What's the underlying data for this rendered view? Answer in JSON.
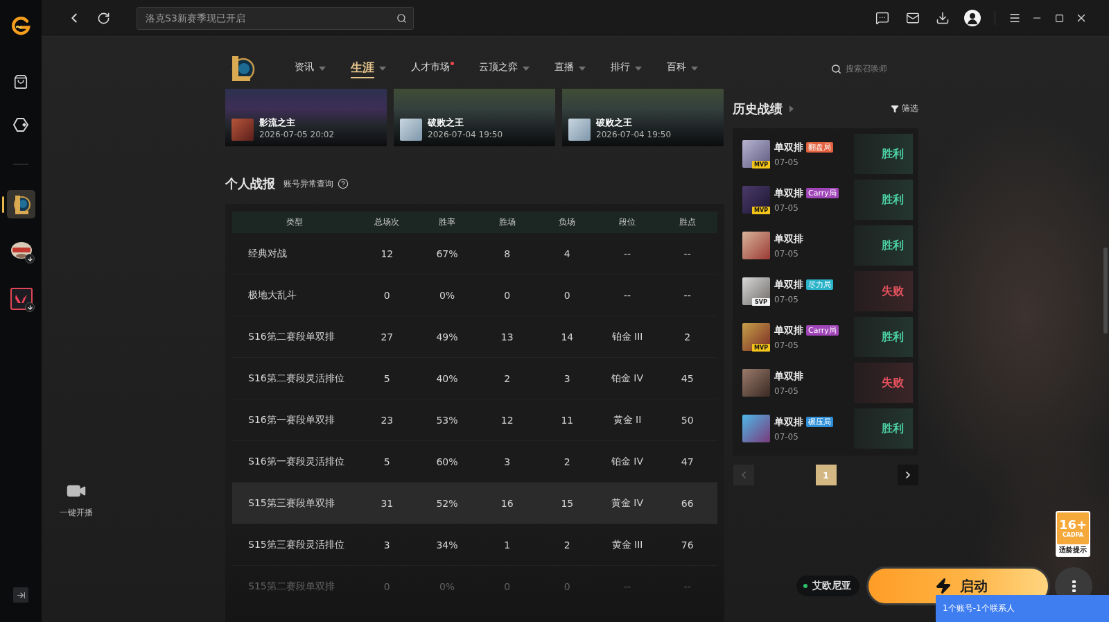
{
  "side_rail": {
    "games": [
      {
        "kind": "emblem",
        "selected": true,
        "installing": false
      },
      {
        "kind": "crest",
        "selected": false,
        "installing": true
      },
      {
        "kind": "square",
        "selected": false,
        "installing": true
      }
    ],
    "live_button": {
      "label": "一键开播"
    }
  },
  "top_bar": {
    "search": {
      "placeholder": "洛克S3新赛季现已开启"
    }
  },
  "game_nav": {
    "tabs": [
      {
        "label": "资讯",
        "selected": false,
        "dropdown": true,
        "dot": false
      },
      {
        "label": "生涯",
        "selected": true,
        "dropdown": true,
        "dot": false
      },
      {
        "label": "人才市场",
        "selected": false,
        "dropdown": false,
        "dot": true
      },
      {
        "label": "云顶之弈",
        "selected": false,
        "dropdown": true,
        "dot": false
      },
      {
        "label": "直播",
        "selected": false,
        "dropdown": true,
        "dot": false
      },
      {
        "label": "排行",
        "selected": false,
        "dropdown": true,
        "dot": false
      },
      {
        "label": "百科",
        "selected": false,
        "dropdown": true,
        "dot": false
      }
    ],
    "search": {
      "placeholder": "搜索召唤师"
    }
  },
  "highlights": [
    {
      "champion": "影流之主",
      "time": "2026-07-05 20:02"
    },
    {
      "champion": "破败之王",
      "time": "2026-07-04 19:50"
    },
    {
      "champion": "破败之王",
      "time": "2026-07-04 19:50"
    }
  ],
  "personal_stats": {
    "title": "个人战报",
    "link": "账号异常查询",
    "table": {
      "columns": [
        "类型",
        "总场次",
        "胜率",
        "胜场",
        "负场",
        "段位",
        "胜点"
      ],
      "rows": [
        {
          "cells": [
            "经典对战",
            "12",
            "67%",
            "8",
            "4",
            "--",
            "--"
          ],
          "highlighted": false
        },
        {
          "cells": [
            "极地大乱斗",
            "0",
            "0%",
            "0",
            "0",
            "--",
            "--"
          ],
          "highlighted": false
        },
        {
          "cells": [
            "S16第二赛段单双排",
            "27",
            "49%",
            "13",
            "14",
            "铂金 III",
            "2"
          ],
          "highlighted": false
        },
        {
          "cells": [
            "S16第二赛段灵活排位",
            "5",
            "40%",
            "2",
            "3",
            "铂金 IV",
            "45"
          ],
          "highlighted": false
        },
        {
          "cells": [
            "S16第一赛段单双排",
            "23",
            "53%",
            "12",
            "11",
            "黄金 II",
            "50"
          ],
          "highlighted": false
        },
        {
          "cells": [
            "S16第一赛段灵活排位",
            "5",
            "60%",
            "3",
            "2",
            "铂金 IV",
            "47"
          ],
          "highlighted": false
        },
        {
          "cells": [
            "S15第三赛段单双排",
            "31",
            "52%",
            "16",
            "15",
            "黄金 IV",
            "66"
          ],
          "highlighted": true
        },
        {
          "cells": [
            "S15第三赛段灵活排位",
            "3",
            "34%",
            "1",
            "2",
            "黄金 III",
            "76"
          ],
          "highlighted": false
        },
        {
          "cells": [
            "S15第二赛段单双排",
            "0",
            "0%",
            "0",
            "0",
            "--",
            "--"
          ],
          "highlighted": false
        }
      ]
    }
  },
  "history": {
    "title": "历史战绩",
    "filter": "筛选",
    "matches": [
      {
        "mode": "单双排",
        "tag": {
          "label": "翻盘局",
          "color": "#e2623f"
        },
        "badge": {
          "label": "MVP",
          "kind": "mvp"
        },
        "date": "07-05",
        "result": "胜利",
        "kind": "win"
      },
      {
        "mode": "单双排",
        "tag": {
          "label": "Carry局",
          "color": "#a046b8"
        },
        "badge": {
          "label": "MVP",
          "kind": "mvp"
        },
        "date": "07-05",
        "result": "胜利",
        "kind": "win"
      },
      {
        "mode": "单双排",
        "date": "07-05",
        "result": "胜利",
        "kind": "win"
      },
      {
        "mode": "单双排",
        "tag": {
          "label": "尽力局",
          "color": "#2ab3c9"
        },
        "badge": {
          "label": "SVP",
          "kind": "svp"
        },
        "date": "07-05",
        "result": "失败",
        "kind": "loss"
      },
      {
        "mode": "单双排",
        "tag": {
          "label": "Carry局",
          "color": "#a046b8"
        },
        "badge": {
          "label": "MVP",
          "kind": "mvp"
        },
        "date": "07-05",
        "result": "胜利",
        "kind": "win"
      },
      {
        "mode": "单双排",
        "date": "07-05",
        "result": "失败",
        "kind": "loss"
      },
      {
        "mode": "单双排",
        "tag": {
          "label": "碾压局",
          "color": "#2f8fd8"
        },
        "date": "07-05",
        "result": "胜利",
        "kind": "win"
      }
    ],
    "pagination": {
      "prev": {
        "disabled": true
      },
      "pages": [
        {
          "label": "1",
          "selected": true
        }
      ],
      "next": {
        "disabled": false
      }
    }
  },
  "launcher": {
    "server": {
      "label": "艾欧尼亚",
      "online": true
    },
    "launch_button": {
      "label": "启动"
    },
    "age_rating": {
      "rating": "16+",
      "org": "CADPA",
      "caption": "适龄提示"
    },
    "notice": "1个账号-1个联系人"
  }
}
